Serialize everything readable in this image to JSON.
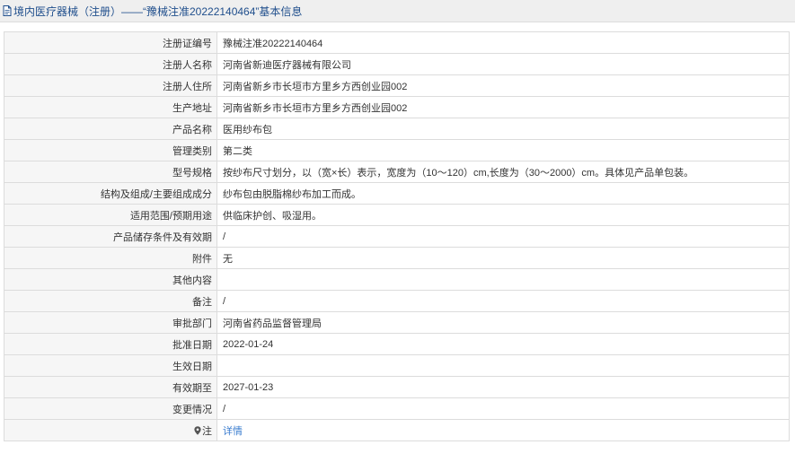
{
  "header": {
    "icon": "document-icon",
    "title": "境内医疗器械（注册）——“豫械注准20222140464”基本信息"
  },
  "rows": [
    {
      "label": "注册证编号",
      "value": "豫械注准20222140464"
    },
    {
      "label": "注册人名称",
      "value": "河南省新迪医疗器械有限公司"
    },
    {
      "label": "注册人住所",
      "value": "河南省新乡市长垣市方里乡方西创业园002"
    },
    {
      "label": "生产地址",
      "value": "河南省新乡市长垣市方里乡方西创业园002"
    },
    {
      "label": "产品名称",
      "value": "医用纱布包"
    },
    {
      "label": "管理类别",
      "value": "第二类"
    },
    {
      "label": "型号规格",
      "value": "按纱布尺寸划分，以（宽×长）表示，宽度为（10～120）cm,长度为（30～2000）cm。具体见产品单包装。"
    },
    {
      "label": "结构及组成/主要组成成分",
      "value": "纱布包由脱脂棉纱布加工而成。"
    },
    {
      "label": "适用范围/预期用途",
      "value": "供临床护创、吸湿用。"
    },
    {
      "label": "产品储存条件及有效期",
      "value": "/"
    },
    {
      "label": "附件",
      "value": "无"
    },
    {
      "label": "其他内容",
      "value": ""
    },
    {
      "label": "备注",
      "value": "/"
    },
    {
      "label": "审批部门",
      "value": "河南省药品监督管理局"
    },
    {
      "label": "批准日期",
      "value": "2022-01-24"
    },
    {
      "label": "生效日期",
      "value": ""
    },
    {
      "label": "有效期至",
      "value": "2027-01-23"
    },
    {
      "label": "变更情况",
      "value": "/"
    },
    {
      "label": "注",
      "label_icon": "location-pin-icon",
      "value": "详情"
    }
  ],
  "colors": {
    "header_text": "#1f4e8c",
    "link": "#3a7ccf",
    "label_bg": "#f6f6f6",
    "border": "#dcdcdc"
  }
}
